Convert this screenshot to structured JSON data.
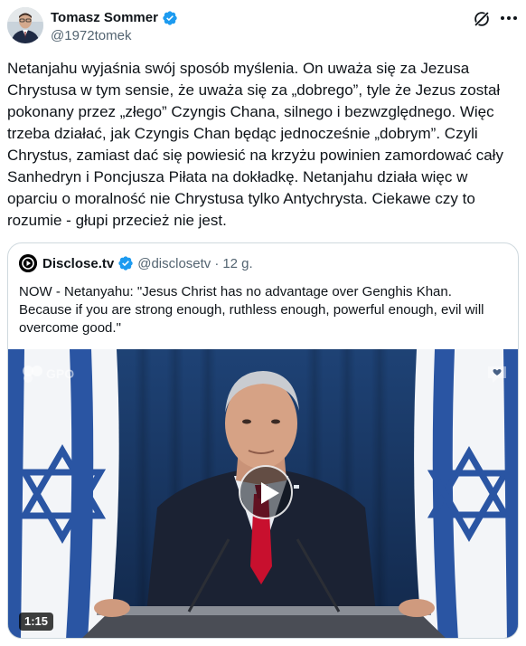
{
  "author": {
    "name": "Tomasz Sommer",
    "handle": "@1972tomek",
    "verified": true
  },
  "tweet": {
    "text": "Netanjahu wyjaśnia swój sposób myślenia. On uważa się za Jezusa Chrystusa w tym sensie, że uważa się za „dobrego”, tyle że Jezus został pokonany przez „złego” Czyngis Chana, silnego i bezwzględnego. Więc trzeba działać, jak Czyngis Chan będąc jednocześnie „dobrym”. Czyli Chrystus, zamiast dać się powiesić na krzyżu powinien zamordować cały Sanhedryn i Poncjusza Piłata na dokładkę. Netanjahu działa więc w oparciu o moralność nie Chrystusa tylko Antychrysta. Ciekawe czy to rozumie - głupi przecież nie jest."
  },
  "quoted": {
    "name": "Disclose.tv",
    "handle": "@disclosetv",
    "dot": "·",
    "time": "12 g.",
    "text": "NOW - Netanyahu: \"Jesus Christ has no advantage over Genghis Khan. Because if you are strong enough, ruthless enough, powerful enough, evil will overcome good.\"",
    "video": {
      "duration": "1:15",
      "watermark": "GPO"
    }
  },
  "colors": {
    "verified_blue": "#1d9bf0",
    "text_primary": "#0f1419",
    "text_secondary": "#536471",
    "border": "#cfd9de"
  },
  "icons": {
    "verified": "verified-badge-icon",
    "grok": "grok-icon",
    "more": "more-horizontal-icon",
    "play": "play-icon"
  }
}
